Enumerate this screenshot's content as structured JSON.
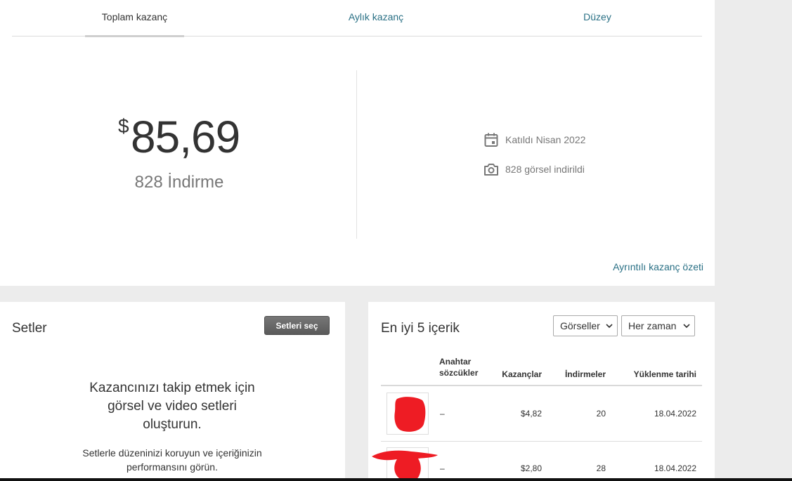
{
  "tabs": [
    {
      "label": "Toplam kazanç",
      "active": true
    },
    {
      "label": "Aylık kazanç",
      "active": false
    },
    {
      "label": "Düzey",
      "active": false
    }
  ],
  "earnings": {
    "currency": "$",
    "amount": "85,69",
    "downloads": "828 İndirme"
  },
  "meta": {
    "joined": "Katıldı Nisan 2022",
    "images_downloaded": "828 görsel indirildi",
    "joined_icon": "calendar-icon",
    "images_icon": "camera-icon"
  },
  "summary_link": "Ayrıntılı kazanç özeti",
  "sets": {
    "title": "Setler",
    "button": "Setleri seç",
    "heading": "Kazancınızı takip etmek için görsel ve video setleri oluşturun.",
    "sub": "Setlerle düzeninizi koruyun ve içeriğinizin performansını görün."
  },
  "top5": {
    "title": "En iyi 5 içerik",
    "type_select": "Görseller",
    "time_select": "Her zaman",
    "columns": {
      "keywords": "Anahtar sözcükler",
      "earnings": "Kazançlar",
      "downloads": "İndirmeler",
      "uploaded": "Yüklenme tarihi"
    },
    "rows": [
      {
        "keywords": "–",
        "earnings": "$4,82",
        "downloads": "20",
        "uploaded": "18.04.2022"
      },
      {
        "keywords": "–",
        "earnings": "$2,80",
        "downloads": "28",
        "uploaded": "18.04.2022"
      }
    ]
  },
  "colors": {
    "link": "#2a7085",
    "redaction": "#ee1c24",
    "background": "#ececec"
  }
}
